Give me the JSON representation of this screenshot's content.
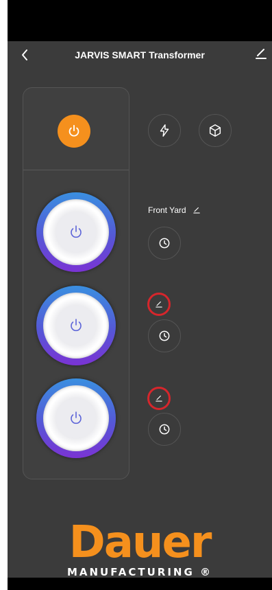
{
  "header": {
    "title": "JARVIS SMART Transformer"
  },
  "zones": [
    {
      "label": "Front Yard"
    },
    {
      "label": ""
    },
    {
      "label": ""
    }
  ],
  "logo": {
    "brand": "Dauer",
    "subtitle": "MANUFACTURING ®"
  },
  "colors": {
    "accent": "#f5901d",
    "background": "#3b3b3b",
    "highlight_ring": "#d6262c"
  },
  "icons": {
    "back": "chevron-left-icon",
    "edit": "pencil-icon",
    "power": "power-icon",
    "flash": "lightning-icon",
    "cube": "cube-icon",
    "timer": "clock-icon"
  }
}
